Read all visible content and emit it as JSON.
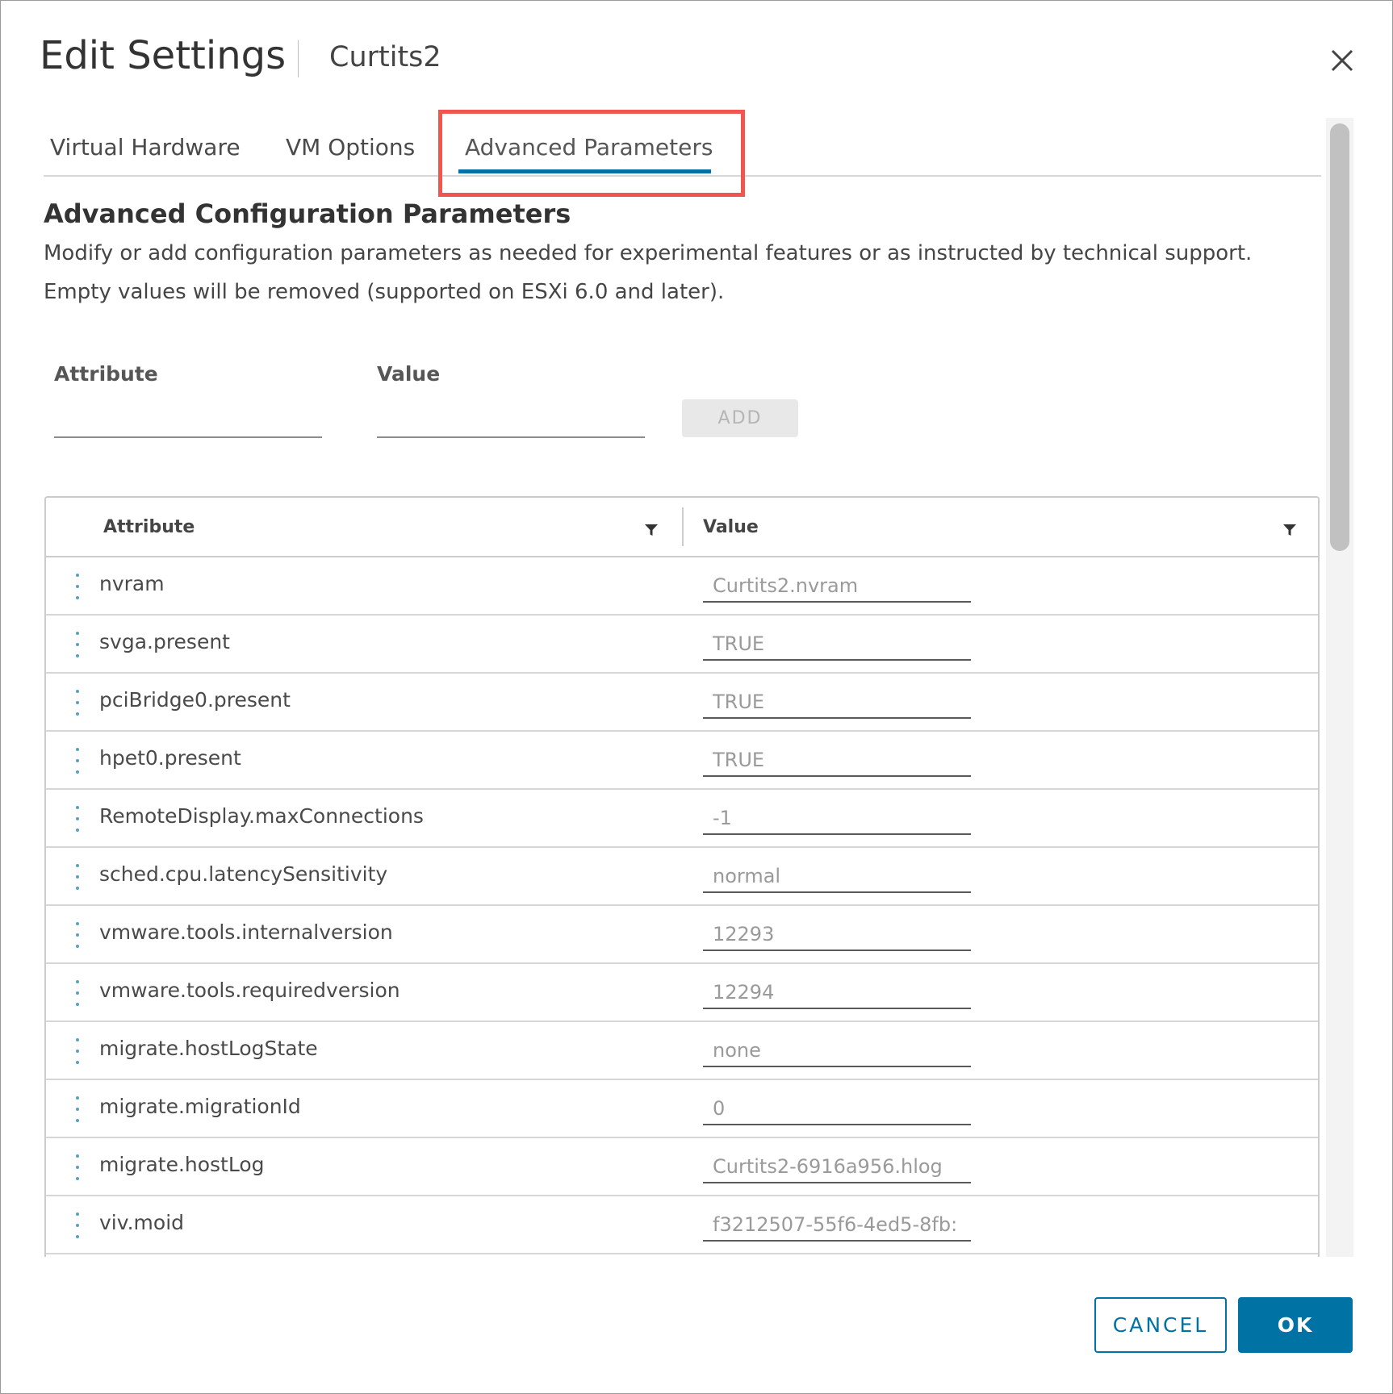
{
  "dialog": {
    "title": "Edit Settings",
    "subtitle": "Curtits2",
    "close_icon": "close-icon"
  },
  "tabs": [
    {
      "label": "Virtual Hardware",
      "active": false
    },
    {
      "label": "VM Options",
      "active": false
    },
    {
      "label": "Advanced Parameters",
      "active": true
    }
  ],
  "section": {
    "title": "Advanced Configuration Parameters",
    "description_line1": "Modify or add configuration parameters as needed for experimental features or as instructed by technical support.",
    "description_line2": "Empty values will be removed (supported on ESXi 6.0 and later)."
  },
  "add_form": {
    "attribute_label": "Attribute",
    "value_label": "Value",
    "attribute_value": "",
    "value_value": "",
    "add_label": "ADD",
    "add_enabled": false
  },
  "grid": {
    "columns": {
      "attribute": "Attribute",
      "value": "Value"
    },
    "rows": [
      {
        "attribute": "nvram",
        "value": "Curtits2.nvram"
      },
      {
        "attribute": "svga.present",
        "value": "TRUE"
      },
      {
        "attribute": "pciBridge0.present",
        "value": "TRUE"
      },
      {
        "attribute": "hpet0.present",
        "value": "TRUE"
      },
      {
        "attribute": "RemoteDisplay.maxConnections",
        "value": "-1"
      },
      {
        "attribute": "sched.cpu.latencySensitivity",
        "value": "normal"
      },
      {
        "attribute": "vmware.tools.internalversion",
        "value": "12293"
      },
      {
        "attribute": "vmware.tools.requiredversion",
        "value": "12294"
      },
      {
        "attribute": "migrate.hostLogState",
        "value": "none"
      },
      {
        "attribute": "migrate.migrationId",
        "value": "0"
      },
      {
        "attribute": "migrate.hostLog",
        "value": "Curtits2-6916a956.hlog"
      },
      {
        "attribute": "viv.moid",
        "value": "f3212507-55f6-4ed5-8fb:"
      }
    ]
  },
  "footer": {
    "cancel_label": "CANCEL",
    "ok_label": "OK"
  },
  "colors": {
    "accent": "#0072a3",
    "highlight": "#f0564f",
    "row_menu": "#5a9fc2"
  }
}
